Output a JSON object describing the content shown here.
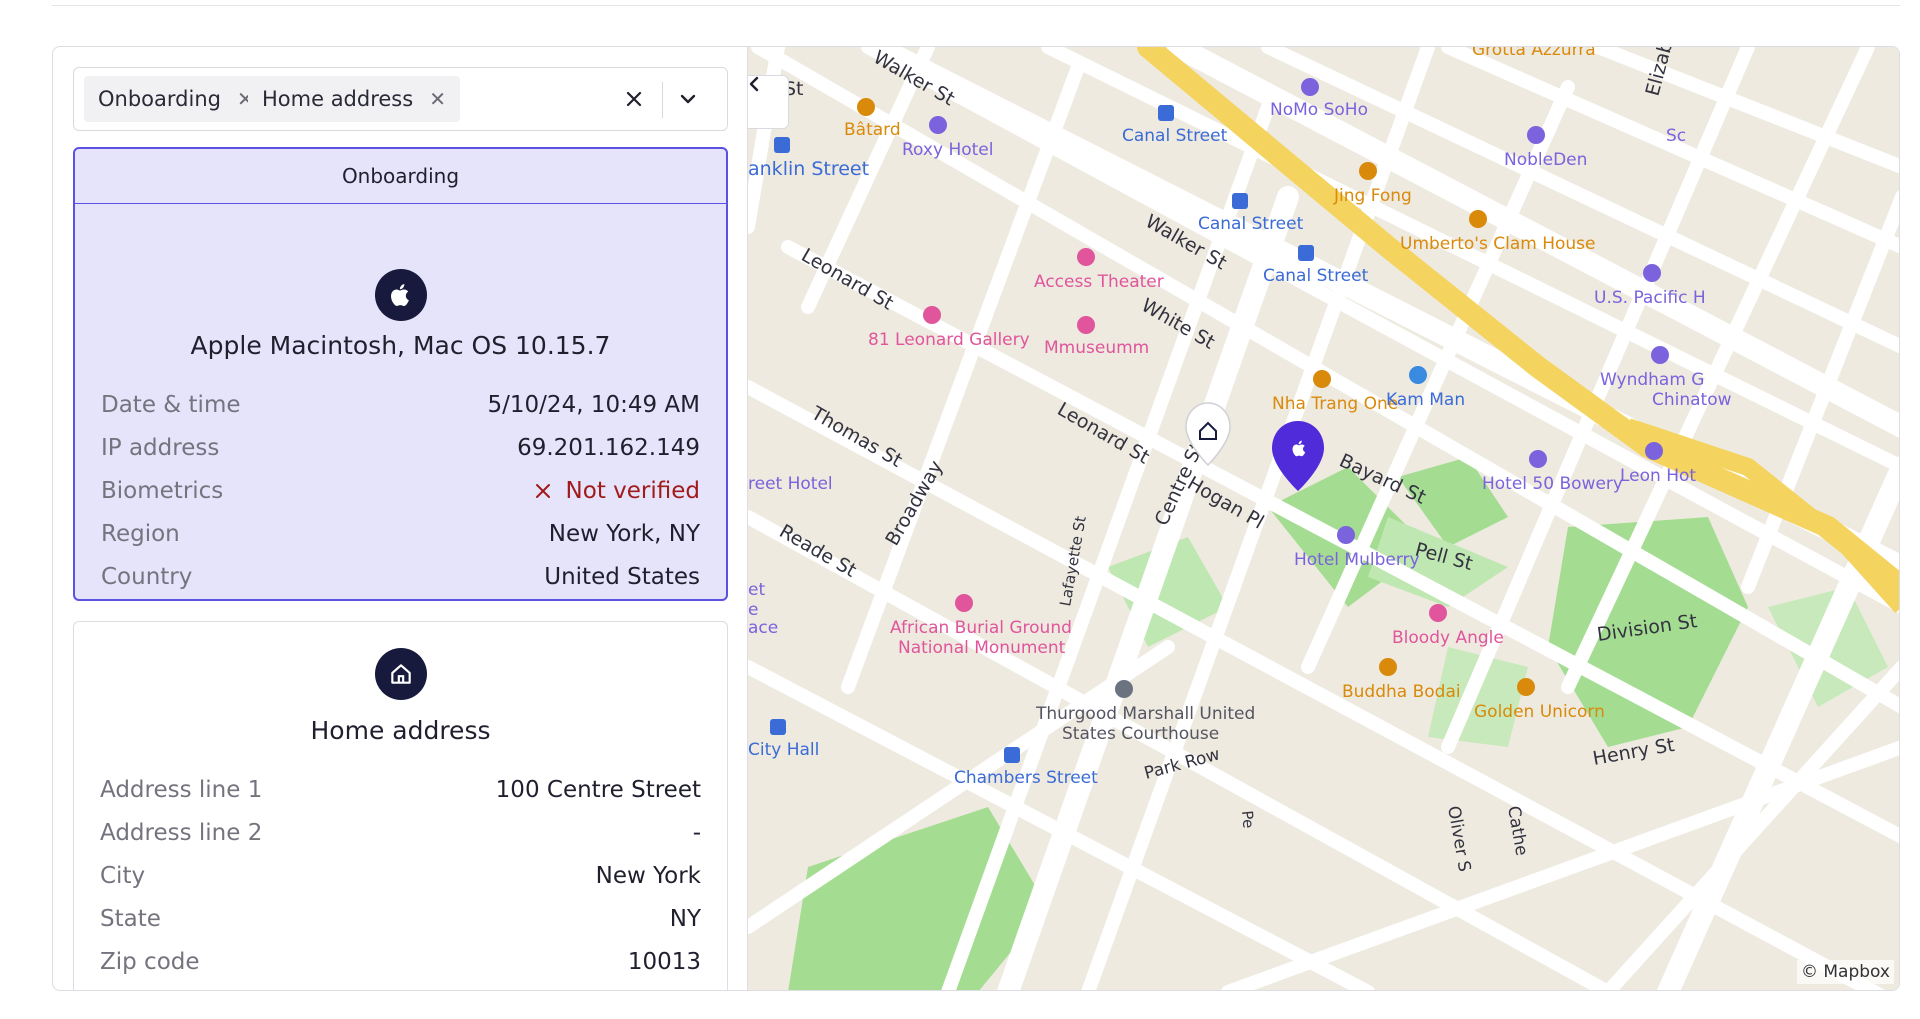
{
  "filter": {
    "chips": [
      {
        "label": "Onboarding"
      },
      {
        "label": "Home address"
      }
    ]
  },
  "device_panel": {
    "header": "Onboarding",
    "icon": "apple-icon",
    "title": "Apple Macintosh, Mac OS 10.15.7",
    "rows": [
      {
        "key": "Date & time",
        "value": "5/10/24, 10:49 AM"
      },
      {
        "key": "IP address",
        "value": "69.201.162.149"
      },
      {
        "key": "Biometrics",
        "value": "Not verified"
      },
      {
        "key": "Region",
        "value": "New York, NY"
      },
      {
        "key": "Country",
        "value": "United States"
      }
    ]
  },
  "address_panel": {
    "icon": "home-icon",
    "title": "Home address",
    "rows": [
      {
        "key": "Address line 1",
        "value": "100 Centre Street"
      },
      {
        "key": "Address line 2",
        "value": "-"
      },
      {
        "key": "City",
        "value": "New York"
      },
      {
        "key": "State",
        "value": "NY"
      },
      {
        "key": "Zip code",
        "value": "10013"
      }
    ]
  },
  "map": {
    "attribution": "© Mapbox",
    "streets": [
      "Walker St",
      "Walker St",
      "Leonard St",
      "Leonard St",
      "White St",
      "Thomas St",
      "Broadway",
      "Reade St",
      "Centre St",
      "Hogan Pl",
      "Bayard St",
      "Pell St",
      "Lafayette St",
      "Division St",
      "Park Row",
      "Henry St",
      "Elizabe",
      "St",
      "anklin Street",
      "Oliver S",
      "Cathe",
      "Pe"
    ],
    "transit": [
      "Canal Street",
      "Canal Street",
      "Canal Street",
      "City Hall",
      "Chambers Street"
    ],
    "food_pois": [
      "Bâtard",
      "Jing Fong",
      "Umberto's Clam House",
      "Nha Trang One",
      "Buddha Bodai",
      "Golden Unicorn",
      "Grotta Azzurra"
    ],
    "hotel_pois": [
      "Roxy Hotel",
      "NoMo SoHo",
      "NobleDen",
      "U.S. Pacific H",
      "Wyndham G",
      "Chinatow",
      "Hotel 50 Bowery",
      "Leon Hot",
      "Hotel Mulberry",
      "reet Hotel",
      "Sc"
    ],
    "culture_pois": [
      "Access Theater",
      "81 Leonard Gallery",
      "Mmuseumm",
      "African Burial Ground",
      "National Monument",
      "Bloody Angle"
    ],
    "shop_pois": [
      "Kam Man"
    ],
    "gov_pois": [
      "Thurgood Marshall United",
      "States Courthouse"
    ],
    "edge_text": [
      "et",
      "e",
      "ace"
    ],
    "colors": {
      "accent": "#5b52e3",
      "pin": "#4f2bd9",
      "food": "#e89a12",
      "hotel": "#8a74e6",
      "culture": "#e0559b",
      "transit": "#3a6bd6",
      "highway": "#f4d35e",
      "park": "#9fdc8e"
    }
  }
}
